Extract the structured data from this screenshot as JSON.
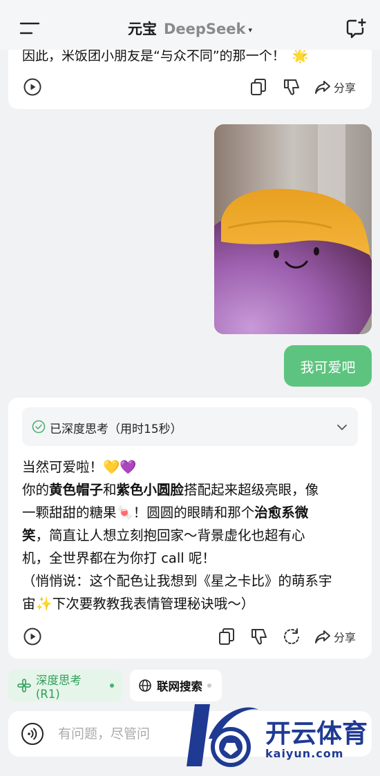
{
  "header": {
    "app_name": "元宝",
    "model_name": "DeepSeek",
    "caret": "▾"
  },
  "previous_reply": {
    "text": "因此，米饭团小朋友是“与众不同”的那一个！",
    "emoji": "🌟",
    "share_label": "分享"
  },
  "user_message": {
    "image_subject": "purple plush toy with yellow cap",
    "text": "我可爱吧"
  },
  "ai_reply": {
    "thinking_label": "已深度思考（用时15秒）",
    "line1": "当然可爱啦！💛💜",
    "line2_pre": "你的",
    "line2_b1": "黄色帽子",
    "line2_mid": "和",
    "line2_b2": "紫色小圆脸",
    "line2_post": "搭配起来超级亮眼，像",
    "line3_pre": "一颗甜甜的糖果🍬！圆圆的眼睛和那个",
    "line3_b": "治愈系微",
    "line4_b": "笑",
    "line4_post": "，简直让人想立刻抱回家～背景虚化也超有心",
    "line5": "机，全世界都在为你打 call 呢！",
    "line6": "（悄悄说：这个配色让我想到《星之卡比》的萌系宇",
    "line7": "宙✨下次要教教我表情管理秘诀哦～）",
    "share_label": "分享"
  },
  "modes": {
    "deep_think": "深度思考(R1)",
    "web_search": "联网搜索"
  },
  "input": {
    "placeholder": "有问题，尽管问"
  },
  "watermark": {
    "title": "开云体育",
    "subtitle": "kaiyun.com"
  },
  "colors": {
    "accent_green": "#5dc47f",
    "deep_think_text": "#2f9e58",
    "watermark_blue": "#1f3a93"
  }
}
